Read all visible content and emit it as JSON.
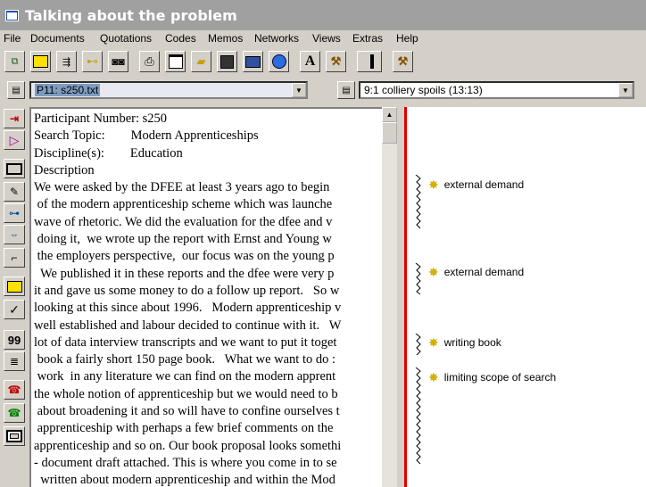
{
  "window": {
    "title": "Talking about the problem"
  },
  "menu": [
    "File",
    "Documents",
    "Quotations",
    "Codes",
    "Memos",
    "Networks",
    "Views",
    "Extras",
    "Help"
  ],
  "toolbar_icons": [
    "network-icon",
    "yellow-box-icon",
    "text-add-icon",
    "code-tree-icon",
    "binoculars-icon",
    "printer-icon",
    "window-icon",
    "open-folder-icon",
    "save-disk-icon",
    "screen-icon",
    "globe-icon",
    "font-a-icon",
    "hammer-icon",
    "back-icon",
    "hammer2-icon"
  ],
  "combos": {
    "document": "P11: s250.txt",
    "quotation": "9:1 colliery spoils (13:13)"
  },
  "side_toolbar_icons": [
    "code-quote-icon",
    "tag-icon",
    "rectangle-icon",
    "edit-icon",
    "hierarchy-icon",
    "code-link-icon",
    "split-icon",
    "yellow-box-icon",
    "check-icon",
    "quote-99-icon",
    "memo-icon",
    "phone-red-icon",
    "phone-green-icon",
    "frame-icon"
  ],
  "document": {
    "lines": [
      "Participant Number: s250",
      "Search Topic:        Modern Apprenticeships",
      "Discipline(s):        Education",
      "Description",
      "We were asked by the DFEE at least 3 years ago to begin",
      " of the modern apprenticeship scheme which was launche",
      "wave of rhetoric.  We did the evaluation for the dfee and v",
      " doing it,  we wrote up the report with Ernst and Young w",
      " the employers perspective,  our focus was on the young p",
      "  We published it in these reports and the dfee were very p",
      "it and gave us some money to do a follow up report.   So w",
      "looking at this since about 1996.   Modern apprenticeship v",
      "well established and labour decided to continue with it.   W",
      "lot of data interview transcripts and we want to put it toget",
      " book a fairly short 150 page book.   What we want to do :",
      " work  in any literature we can find on the modern apprent",
      "the whole notion of apprenticeship but we would need to b",
      " about broadening it and so will have to confine ourselves t",
      " apprenticeship with perhaps a few brief comments on the",
      "apprenticeship and so on. Our book proposal looks somethi",
      "- document draft attached. This is where you come in to se",
      "  written about modern apprenticeship and within the Mod"
    ]
  },
  "margin_codes": [
    {
      "label": "external demand"
    },
    {
      "label": "external demand"
    },
    {
      "label": "writing book"
    },
    {
      "label": "limiting scope of search"
    }
  ]
}
